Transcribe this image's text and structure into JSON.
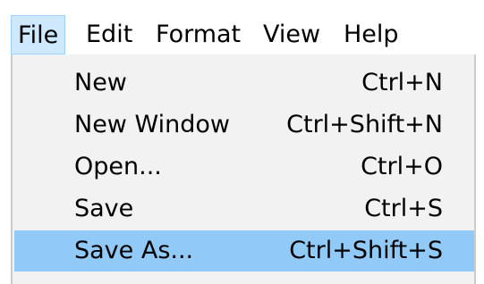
{
  "menubar": {
    "items": [
      {
        "label": "File"
      },
      {
        "label": "Edit"
      },
      {
        "label": "Format"
      },
      {
        "label": "View"
      },
      {
        "label": "Help"
      }
    ]
  },
  "file_menu": {
    "items": [
      {
        "label": "New",
        "shortcut": "Ctrl+N"
      },
      {
        "label": "New Window",
        "shortcut": "Ctrl+Shift+N"
      },
      {
        "label": "Open...",
        "shortcut": "Ctrl+O"
      },
      {
        "label": "Save",
        "shortcut": "Ctrl+S"
      },
      {
        "label": "Save As...",
        "shortcut": "Ctrl+Shift+S"
      }
    ]
  }
}
